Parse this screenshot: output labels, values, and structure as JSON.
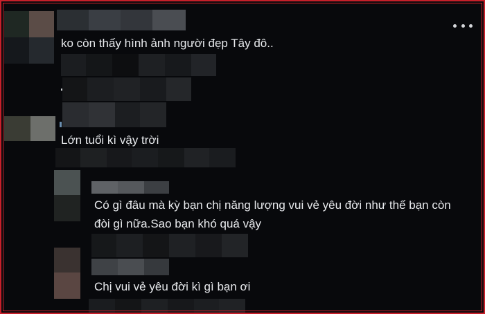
{
  "thread": {
    "comment_1": {
      "text": "ko còn thấy hình ảnh người đẹp Tây đô.."
    },
    "comment_2": {
      "text": "Lớn tuổi kì vậy trời"
    },
    "reply_1": {
      "text_line1": "Có gì đâu mà kỳ bạn chị năng lượng vui vẻ yêu đời như thế bạn còn",
      "text_line2": "đòi gì nữa.Sao bạn khó quá vậy"
    },
    "reply_2": {
      "text": "Chị vui vẻ yêu đời kì gì bạn ơi"
    }
  },
  "menu": {
    "icon": "more-options-icon"
  }
}
